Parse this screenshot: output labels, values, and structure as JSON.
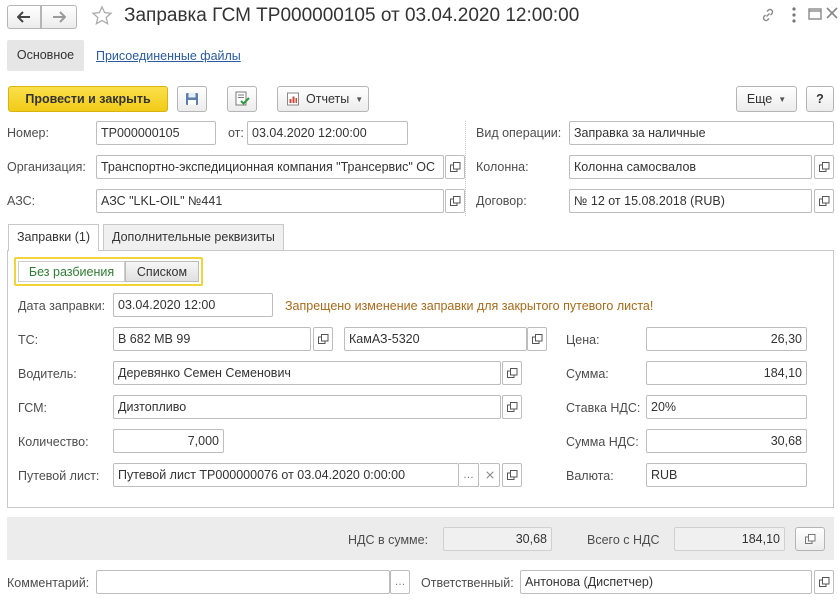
{
  "window": {
    "title": "Заправка ГСМ ТР000000105 от 03.04.2020 12:00:00"
  },
  "sections": {
    "main": "Основное",
    "files": "Присоединенные файлы"
  },
  "toolbar": {
    "post_close": "Провести и закрыть",
    "reports": "Отчеты",
    "more": "Еще",
    "help": "?"
  },
  "header": {
    "number_label": "Номер:",
    "number_value": "ТР000000105",
    "date_label": "от:",
    "date_value": "03.04.2020 12:00:00",
    "operation_label": "Вид операции:",
    "operation_value": "Заправка за наличные",
    "org_label": "Организация:",
    "org_value": "Транспортно-экспедиционная компания \"Трансервис\" ОС",
    "column_label": "Колонна:",
    "column_value": "Колонна самосвалов",
    "azs_label": "АЗС:",
    "azs_value": "АЗС \"LKL-OIL\" №441",
    "contract_label": "Договор:",
    "contract_value": "№ 12 от 15.08.2018 (RUB)"
  },
  "tabs": {
    "refuels": "Заправки (1)",
    "extra": "Дополнительные реквизиты"
  },
  "toggle": {
    "no_split": "Без разбиения",
    "list": "Списком"
  },
  "form": {
    "refuel_date_label": "Дата заправки:",
    "refuel_date_value": "03.04.2020 12:00",
    "warning": "Запрещено изменение заправки для закрытого путевого листа!",
    "vehicle_label": "ТС:",
    "vehicle_plate": "В 682 МВ 99",
    "vehicle_model": "КамАЗ-5320",
    "driver_label": "Водитель:",
    "driver_value": "Деревянко Семен Семенович",
    "fuel_label": "ГСМ:",
    "fuel_value": "Дизтопливо",
    "qty_label": "Количество:",
    "qty_value": "7,000",
    "waybill_label": "Путевой лист:",
    "waybill_value": "Путевой лист ТР000000076 от 03.04.2020 0:00:00",
    "price_label": "Цена:",
    "price_value": "26,30",
    "sum_label": "Сумма:",
    "sum_value": "184,10",
    "vat_rate_label": "Ставка НДС:",
    "vat_rate_value": "20%",
    "vat_sum_label": "Сумма НДС:",
    "vat_sum_value": "30,68",
    "currency_label": "Валюта:",
    "currency_value": "RUB"
  },
  "totals": {
    "vat_in_sum_label": "НДС в сумме:",
    "vat_in_sum_value": "30,68",
    "total_label": "Всего с НДС",
    "total_value": "184,10"
  },
  "footer": {
    "comment_label": "Комментарий:",
    "comment_value": "",
    "responsible_label": "Ответственный:",
    "responsible_value": "Антонова (Диспетчер)"
  },
  "icons": {
    "back": "arrow-left-icon",
    "forward": "arrow-right-icon",
    "favorite": "star-icon",
    "link": "link-icon",
    "menu": "kebab-icon",
    "max": "maximize-icon",
    "close": "close-icon",
    "save": "floppy-icon",
    "post": "post-document-icon",
    "report": "report-icon",
    "open": "open-form-icon"
  },
  "colors": {
    "primary_button": "#f4d223",
    "link": "#2a5b9c",
    "warning": "#a56b1a",
    "toggle_active_text": "#2e7d32"
  }
}
